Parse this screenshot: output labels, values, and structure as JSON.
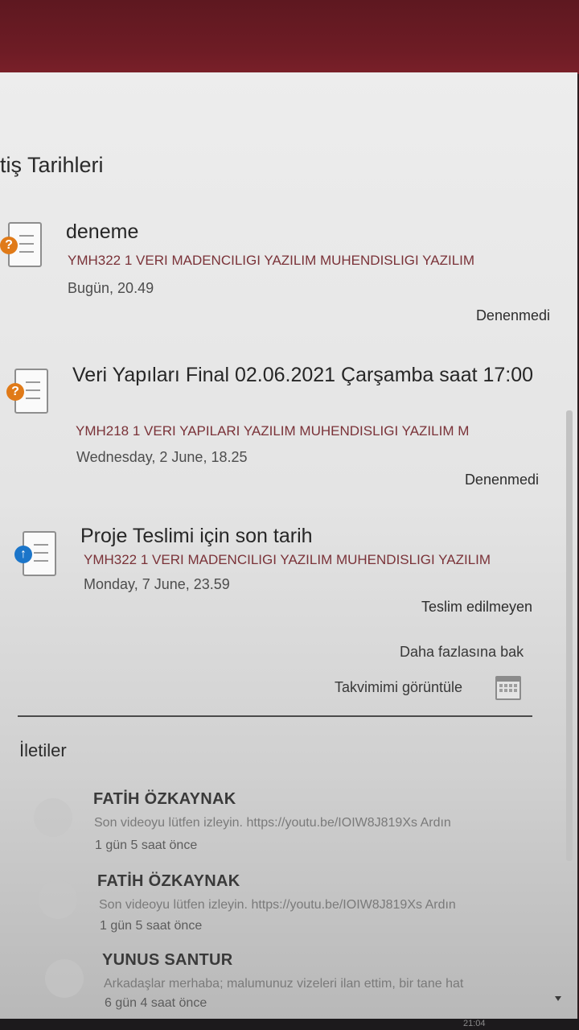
{
  "section_title": "itiş Tarihleri",
  "events": [
    {
      "name": "deneme",
      "course": "YMH322 1 VERI MADENCILIGI YAZILIM MUHENDISLIGI YAZILIM",
      "date": "Bugün, 20.49",
      "status": "Denenmedi",
      "icon": "quiz-icon",
      "badge": "?"
    },
    {
      "name": "Veri Yapıları Final 02.06.2021 Çarşamba saat 17:00",
      "course": "YMH218 1 VERI YAPILARI YAZILIM MUHENDISLIGI YAZILIM M",
      "date": "Wednesday, 2 June, 18.25",
      "status": "Denenmedi",
      "icon": "quiz-icon",
      "badge": "?"
    },
    {
      "name": "Proje Teslimi için son tarih",
      "course": "YMH322 1 VERI MADENCILIGI YAZILIM MUHENDISLIGI YAZILIM",
      "date": "Monday, 7 June, 23.59",
      "status": "Teslim edilmeyen",
      "icon": "assignment-icon",
      "badge": "↑"
    }
  ],
  "more_link": "Daha fazlasına bak",
  "calendar_link": "Takvimimi görüntüle",
  "messages_title": "İletiler",
  "messages": [
    {
      "author": "FATİH ÖZKAYNAK",
      "text": "Son videoyu lütfen izleyin. https://youtu.be/IOIW8J819Xs Ardın",
      "time": "1 gün 5 saat önce"
    },
    {
      "author": "FATİH ÖZKAYNAK",
      "text": "Son videoyu lütfen izleyin. https://youtu.be/IOIW8J819Xs Ardın",
      "time": "1 gün 5 saat önce"
    },
    {
      "author": "YUNUS SANTUR",
      "text": "Arkadaşlar merhaba; malumunuz vizeleri ilan ettim, bir tane hat",
      "time": "6 gün 4 saat önce"
    }
  ],
  "clock": "21:04",
  "colors": {
    "quiz_badge": "#e07a18",
    "assignment_badge": "#1b75c9",
    "topbar": "#6e1c25"
  }
}
